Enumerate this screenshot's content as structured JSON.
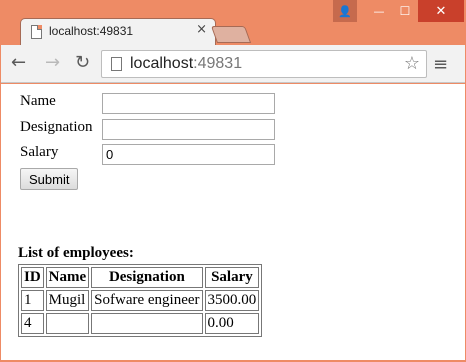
{
  "browser": {
    "tab_title": "localhost:49831",
    "tab_close": "×",
    "url_host": "localhost",
    "url_port": ":49831",
    "back": "←",
    "forward": "→",
    "reload": "↻",
    "star": "☆",
    "menu": "≡",
    "user": "👤",
    "minimize": "—",
    "maximize": "☐",
    "close": "✕"
  },
  "form": {
    "name_label": "Name",
    "name_value": "",
    "designation_label": "Designation",
    "designation_value": "",
    "salary_label": "Salary",
    "salary_value": "0",
    "submit_label": "Submit"
  },
  "employees": {
    "title": "List of employees:",
    "headers": [
      "ID",
      "Name",
      "Designation",
      "Salary"
    ],
    "rows": [
      [
        "1",
        "Mugil",
        "Sofware engineer",
        "3500.00"
      ],
      [
        "4",
        "",
        "",
        "0.00"
      ]
    ]
  }
}
